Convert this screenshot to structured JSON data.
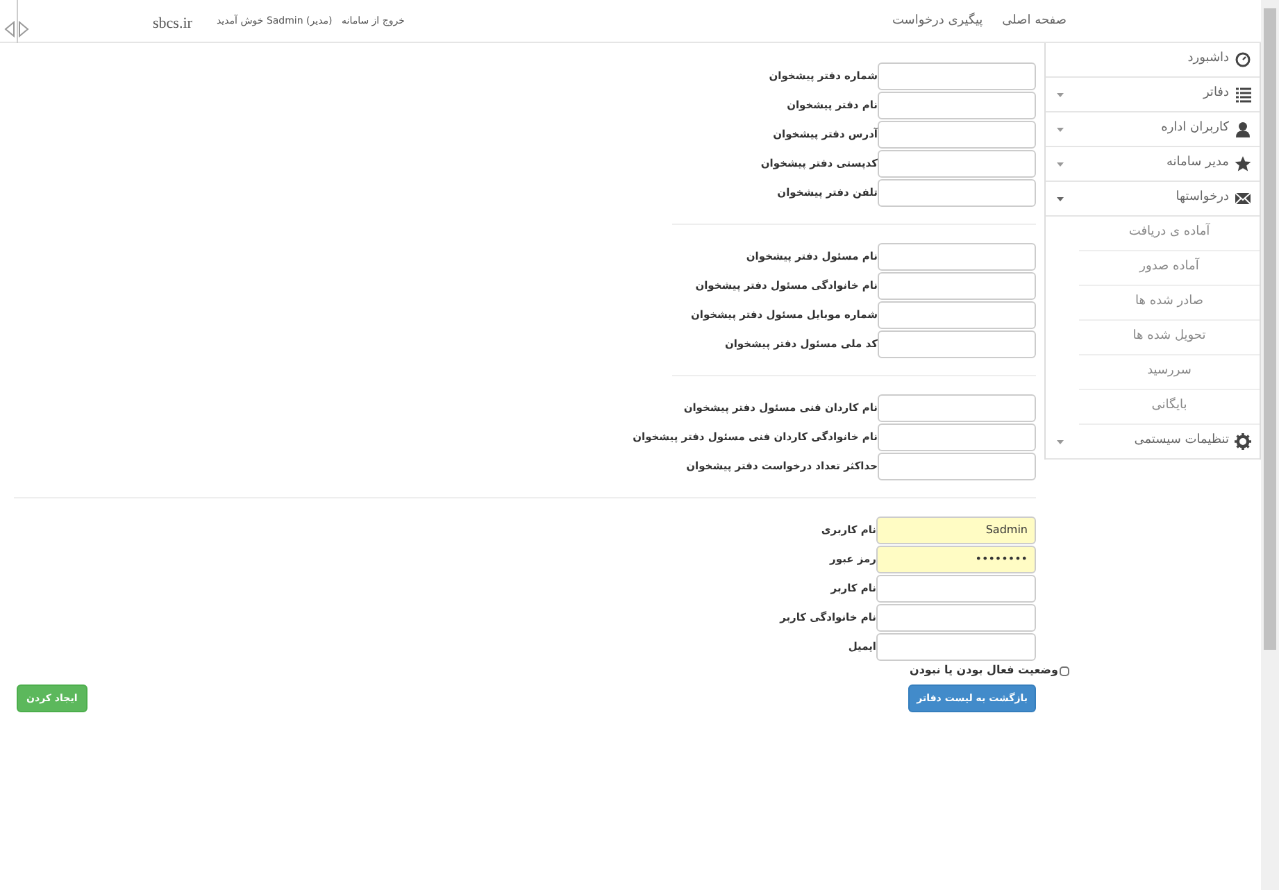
{
  "header": {
    "nav": [
      "صفحه اصلی",
      "پیگیری درخواست"
    ],
    "logout": "خروج از سامانه",
    "welcome": "(مدیر) Sadmin خوش آمدید",
    "site": "sbcs.ir"
  },
  "sidebar": {
    "items": [
      {
        "label": "داشبورد"
      },
      {
        "label": "دفاتر",
        "expanded": false
      },
      {
        "label": "کاربران اداره",
        "expanded": false
      },
      {
        "label": "مدیر سامانه",
        "expanded": false
      },
      {
        "label": "درخواستها",
        "expanded": true,
        "children": [
          {
            "label": "آماده ی دریافت"
          },
          {
            "label": "آماده صدور"
          },
          {
            "label": "صادر شده ها"
          },
          {
            "label": "تحویل شده ها"
          },
          {
            "label": "سررسید"
          },
          {
            "label": "بایگانی"
          }
        ]
      },
      {
        "label": "تنظیمات سیستمی",
        "expanded": false
      }
    ]
  },
  "office_form": {
    "sections": [
      [
        "شماره دفتر پیشخوان",
        "نام دفتر پیشخوان",
        "آدرس دفتر پیشخوان",
        "کدپستی دفتر پیشخوان",
        "تلفن دفتر پیشخوان"
      ],
      [
        "نام مسئول دفتر پیشخوان",
        "نام خانوادگی مسئول دفتر پیشخوان",
        "شماره موبایل مسئول دفتر پیشخوان",
        "کد ملی مسئول دفتر پیشخوان"
      ],
      [
        "نام کاردان فنی مسئول دفتر پیشخوان",
        "نام خانوادگی کاردان فنی مسئول دفتر پیشخوان",
        "حداکثر تعداد درخواست دفتر پیشخوان"
      ]
    ]
  },
  "user_form": {
    "fields": [
      {
        "label": "نام کاربری",
        "value": "Sadmin",
        "autofilled": true
      },
      {
        "label": "رمز عبور",
        "value": "••••••••",
        "autofilled": true
      },
      {
        "label": "نام کاربر",
        "autofilled": false
      },
      {
        "label": "نام خانوادگی کاربر",
        "autofilled": false
      },
      {
        "label": "ایمیل",
        "autofilled": false
      }
    ],
    "active_checkbox": {
      "label": "وضعیت فعال بودن یا نبودن",
      "checked": false
    }
  },
  "buttons": {
    "back": "بازگشت به لیست دفاتر",
    "create": "ایجاد کردن"
  }
}
